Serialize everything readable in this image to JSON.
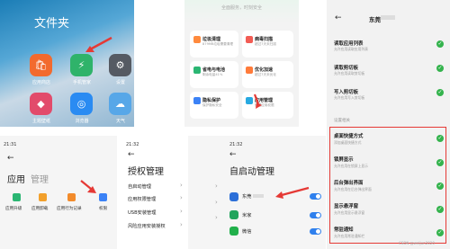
{
  "folder": {
    "title": "文件夹",
    "apps": [
      {
        "label": "应用商店",
        "color": "#f26a2e",
        "icon": "mi-store-icon"
      },
      {
        "label": "手机管家",
        "color": "#2fb36a",
        "icon": "shield-icon"
      },
      {
        "label": "设置",
        "color": "#555a63",
        "icon": "settings-icon"
      },
      {
        "label": "主题壁纸",
        "color": "#e24b6b",
        "icon": "theme-icon"
      },
      {
        "label": "浏览器",
        "color": "#2a8bf2",
        "icon": "browser-icon"
      },
      {
        "label": "天气",
        "color": "#57a7e8",
        "icon": "weather-icon"
      }
    ]
  },
  "manager": {
    "header_text": "全面服务，时刻安全",
    "cards": [
      {
        "title": "垃圾清理",
        "sub": "879MB垃圾需要清理",
        "color": "#ff8a3d"
      },
      {
        "title": "病毒扫描",
        "sub": "超过7天未扫描",
        "color": "#f25c54"
      },
      {
        "title": "省电与电池",
        "sub": "剩余电量41%",
        "color": "#2bb673"
      },
      {
        "title": "优化加速",
        "sub": "超过7天未优化",
        "color": "#ff7b3a"
      },
      {
        "title": "隐私保护",
        "sub": "保护隐私安全",
        "color": "#3b82f6"
      },
      {
        "title": "应用管理",
        "sub": "管理应用权限",
        "color": "#27a9e1"
      }
    ]
  },
  "app_manage": {
    "time": "21:31",
    "title": "应用",
    "title_secondary": "管理",
    "buttons": [
      {
        "label": "应用升级",
        "color": "#2bb673",
        "icon": "upgrade-icon"
      },
      {
        "label": "应用卸载",
        "color": "#f2a02b",
        "icon": "uninstall-icon"
      },
      {
        "label": "应用行为记录",
        "color": "#f28b2b",
        "icon": "record-icon"
      },
      {
        "label": "权限",
        "color": "#3b82f6",
        "icon": "permission-icon"
      }
    ]
  },
  "auth_manage": {
    "time": "21:32",
    "title": "授权管理",
    "items": [
      "自启动管理",
      "应用权限管理",
      "USB安装管理",
      "风险应用安装授权"
    ]
  },
  "autostart": {
    "time": "21:32",
    "title": "自启动管理",
    "apps": [
      {
        "name": "东莞",
        "color": "#2c6fd8",
        "on": true
      },
      {
        "name": "米家",
        "color": "#22a45d",
        "on": true
      },
      {
        "name": "微信",
        "color": "#21b04b",
        "on": true
      }
    ]
  },
  "permissions": {
    "app_name": "东莞",
    "read_items": [
      {
        "title": "读取应用列表",
        "sub": "允许应用读取应用列表"
      },
      {
        "title": "读取剪切板",
        "sub": "允许应用读取剪切板"
      },
      {
        "title": "写入剪切板",
        "sub": "允许应用写入剪切板"
      }
    ],
    "section_title": "设置相关",
    "highlight_items": [
      {
        "title": "桌面快捷方式",
        "sub": "添加桌面快捷方式"
      },
      {
        "title": "锁屏显示",
        "sub": "允许应用在锁屏上显示"
      },
      {
        "title": "后台弹出界面",
        "sub": "允许应用在后台弹出界面"
      },
      {
        "title": "显示悬浮窗",
        "sub": "允许应用显示悬浮窗"
      },
      {
        "title": "常驻通知",
        "sub": "允许应用常驻通知栏"
      }
    ],
    "watermark": "CSDN @weijun2020",
    "accent": "#e53935",
    "check_color": "#34b34d"
  }
}
